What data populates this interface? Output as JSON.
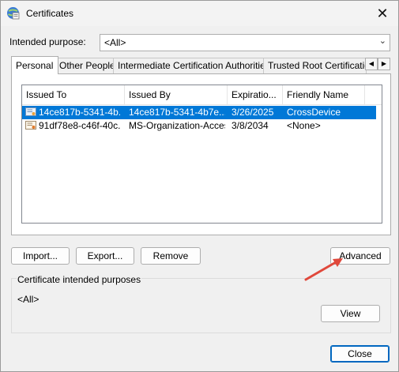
{
  "window": {
    "title": "Certificates",
    "close_glyph": "✕"
  },
  "purpose": {
    "label": "Intended purpose:",
    "value": "<All>"
  },
  "tabs": [
    {
      "label": "Personal"
    },
    {
      "label": "Other People"
    },
    {
      "label": "Intermediate Certification Authorities"
    },
    {
      "label": "Trusted Root Certification"
    }
  ],
  "tab_scroll": {
    "left": "◀",
    "right": "▶"
  },
  "table": {
    "columns": [
      "Issued To",
      "Issued By",
      "Expiratio...",
      "Friendly Name"
    ],
    "rows": [
      {
        "issued_to": "14ce817b-5341-4b...",
        "issued_by": "14ce817b-5341-4b7e...",
        "expiration": "3/26/2025",
        "friendly_name": "CrossDevice",
        "selected": true
      },
      {
        "issued_to": "91df78e8-c46f-40c...",
        "issued_by": "MS-Organization-Access",
        "expiration": "3/8/2034",
        "friendly_name": "<None>",
        "selected": false
      }
    ]
  },
  "buttons": {
    "import": "Import...",
    "export": "Export...",
    "remove": "Remove",
    "advanced": "Advanced",
    "view": "View",
    "close": "Close"
  },
  "purposes_group": {
    "label": "Certificate intended purposes",
    "value": "<All>"
  },
  "colors": {
    "selection": "#0078d7",
    "annotation_arrow": "#e0483b"
  }
}
